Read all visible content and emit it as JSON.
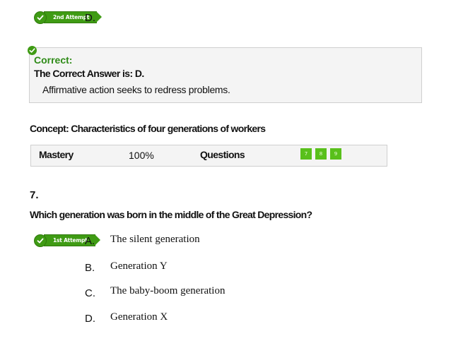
{
  "previous_question": {
    "attempt_badge": "2nd Attempt",
    "selected_letter": "D."
  },
  "feedback": {
    "status": "Correct:",
    "answer_line": "The Correct Answer is: D.",
    "explanation": "Affirmative action seeks to redress problems."
  },
  "concept": {
    "title": "Concept: Characteristics of four generations of workers",
    "mastery_label": "Mastery",
    "mastery_value": "100%",
    "questions_label": "Questions",
    "questions": [
      "7",
      "8",
      "9"
    ]
  },
  "question": {
    "number": "7.",
    "text": "Which generation was born in the middle of the Great Depression?",
    "attempt_badge": "1st Attempt",
    "options": [
      {
        "letter": "A.",
        "text": "The silent generation"
      },
      {
        "letter": "B.",
        "text": "Generation Y"
      },
      {
        "letter": "C.",
        "text": "The baby-boom generation"
      },
      {
        "letter": "D.",
        "text": "Generation X"
      }
    ]
  },
  "colors": {
    "accent_green": "#3f9b14",
    "correct_text": "#2e8b17",
    "question_square": "#59c01b"
  }
}
